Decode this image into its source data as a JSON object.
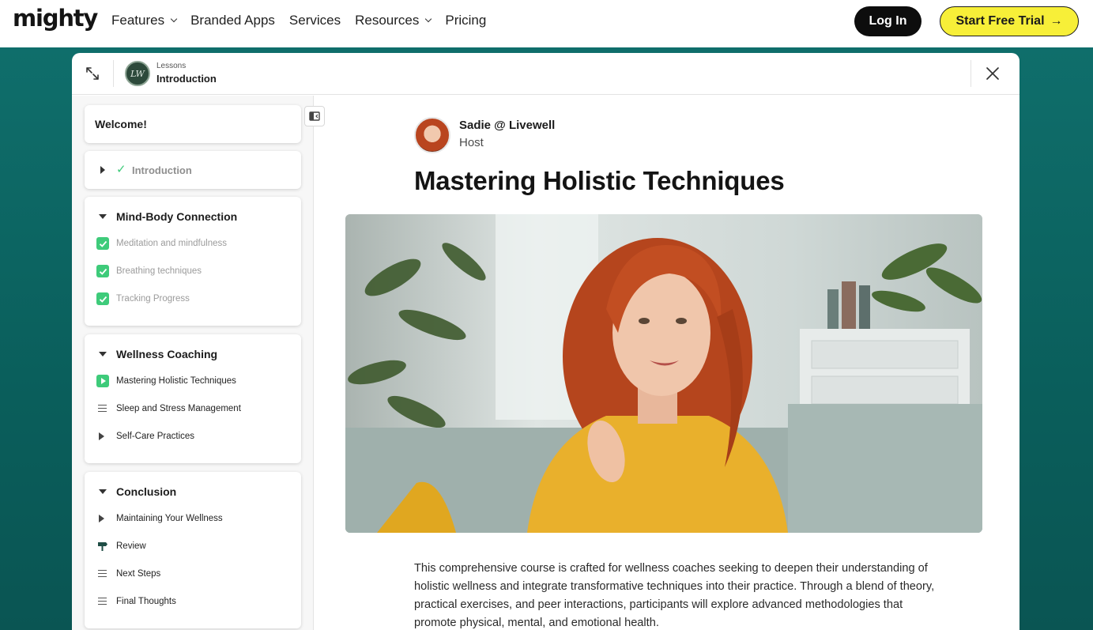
{
  "nav": {
    "logo": "mighty",
    "links": [
      {
        "label": "Features",
        "has_dropdown": true
      },
      {
        "label": "Branded Apps",
        "has_dropdown": false
      },
      {
        "label": "Services",
        "has_dropdown": false
      },
      {
        "label": "Resources",
        "has_dropdown": true
      },
      {
        "label": "Pricing",
        "has_dropdown": false
      }
    ],
    "login_label": "Log In",
    "trial_label": "Start Free Trial",
    "trial_arrow": "→"
  },
  "modal": {
    "header": {
      "badge_text": "LW",
      "subtitle": "Lessons",
      "title": "Introduction"
    },
    "sidebar": {
      "welcome": "Welcome!",
      "intro": {
        "label": "Introduction",
        "check": "✓"
      },
      "sections": [
        {
          "title": "Mind-Body Connection",
          "items": [
            {
              "label": "Meditation and mindfulness",
              "icon": "checkbox-checked-icon"
            },
            {
              "label": "Breathing techniques",
              "icon": "checkbox-checked-icon"
            },
            {
              "label": "Tracking Progress",
              "icon": "checkbox-checked-icon"
            }
          ]
        },
        {
          "title": "Wellness Coaching",
          "items": [
            {
              "label": "Mastering Holistic Techniques",
              "icon": "video-play-icon"
            },
            {
              "label": "Sleep and Stress Management",
              "icon": "text-lines-icon"
            },
            {
              "label": "Self-Care Practices",
              "icon": "play-icon"
            }
          ]
        },
        {
          "title": "Conclusion",
          "items": [
            {
              "label": "Maintaining Your Wellness",
              "icon": "play-icon"
            },
            {
              "label": "Review",
              "icon": "signpost-icon"
            },
            {
              "label": "Next Steps",
              "icon": "text-lines-icon"
            },
            {
              "label": "Final Thoughts",
              "icon": "text-lines-icon"
            }
          ]
        }
      ]
    },
    "content": {
      "host_name": "Sadie @ Livewell",
      "host_role": "Host",
      "title": "Mastering Holistic Techniques",
      "description": "This comprehensive course is crafted for wellness coaches seeking to deepen their understanding of holistic wellness and integrate transformative techniques into their practice. Through a blend of theory, practical exercises, and peer interactions, participants will explore advanced methodologies that promote physical, mental, and emotional health."
    }
  },
  "colors": {
    "brand_teal": "#0f6e6b",
    "accent_yellow": "#f7ef38",
    "complete_green": "#3ecb7a"
  }
}
